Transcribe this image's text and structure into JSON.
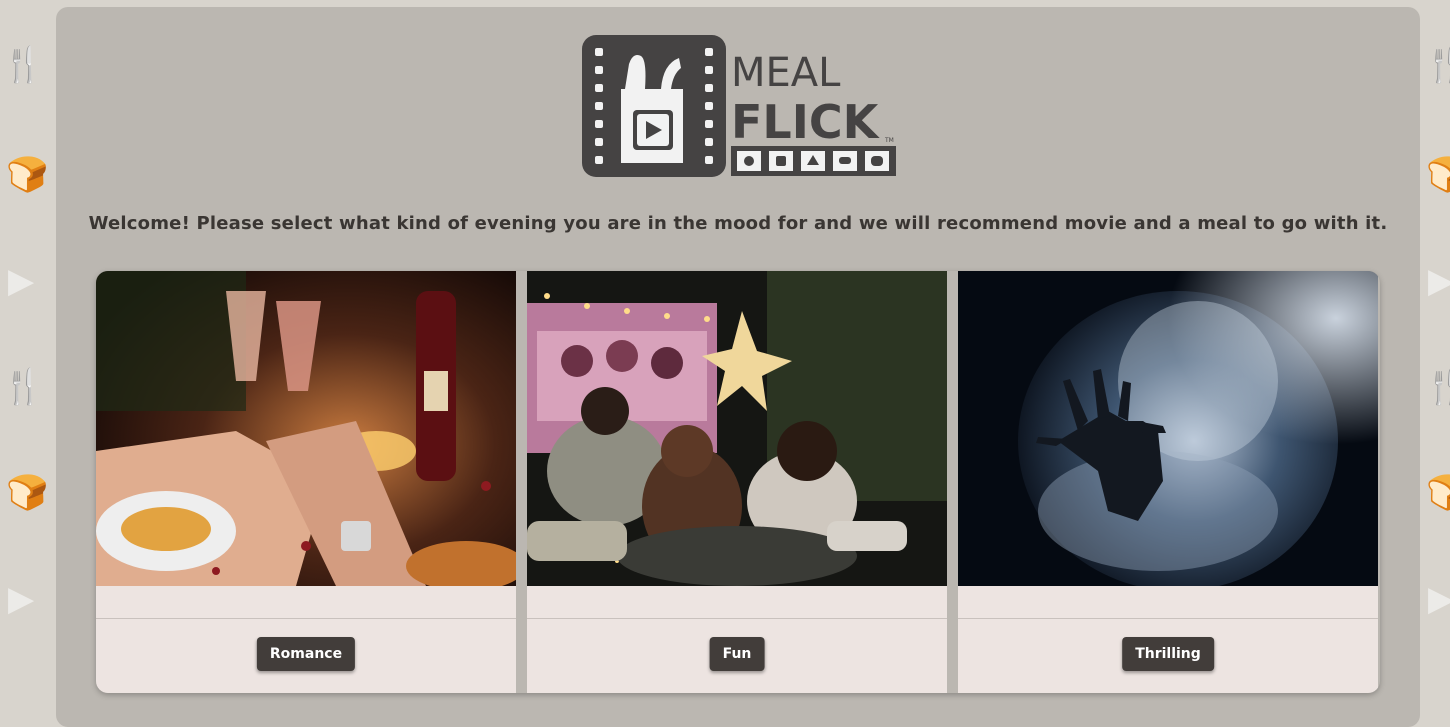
{
  "brand": {
    "word1": "MEAL",
    "word2": "FLICK",
    "tm": "TM"
  },
  "welcome": "Welcome! Please select what kind of evening you are in the mood for and we will recommend movie and a meal to go with it.",
  "cards": [
    {
      "label": "Romance",
      "image": "romantic-dinner-wine-toast-photo"
    },
    {
      "label": "Fun",
      "image": "backyard-movie-night-photo"
    },
    {
      "label": "Thrilling",
      "image": "hand-reaching-through-smoke-photo"
    }
  ],
  "colors": {
    "button": "#423d3a",
    "panel": "#bbb7b1",
    "card": "#ede4e1"
  }
}
